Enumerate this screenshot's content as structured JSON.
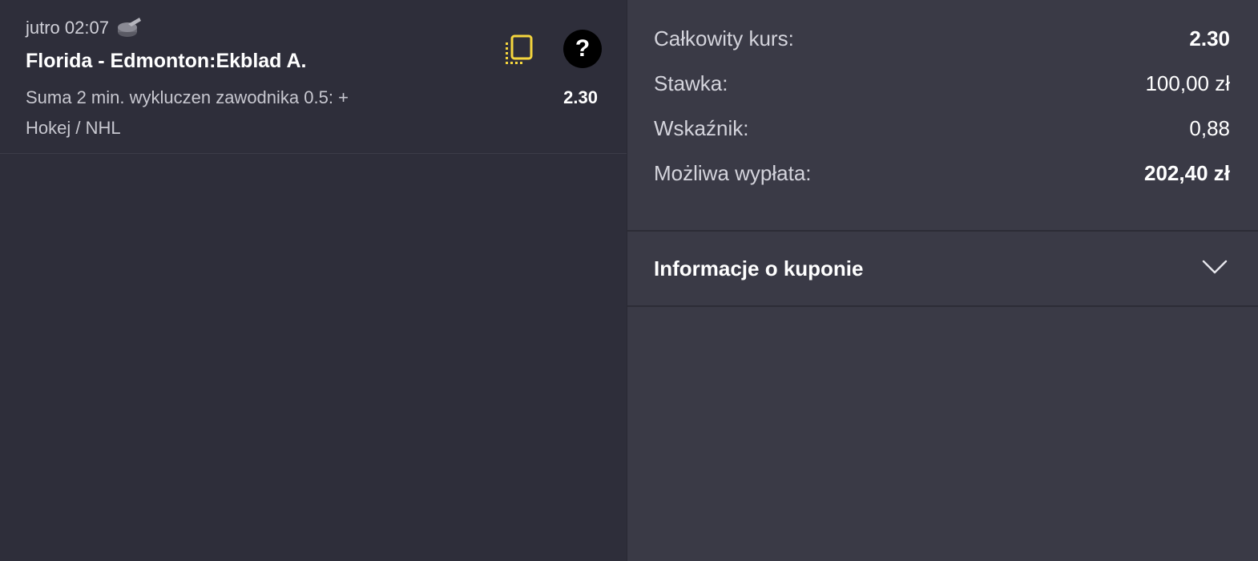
{
  "bet": {
    "time": "jutro 02:07",
    "title": "Florida - Edmonton:Ekblad A.",
    "market": "Suma 2 min. wykluczen zawodnika 0.5: +",
    "odds": "2.30",
    "sport": "Hokej / NHL",
    "icons": {
      "sport": "hockey-puck-icon",
      "copy": "copy-icon",
      "help": "help-icon"
    },
    "help_glyph": "?"
  },
  "summary": {
    "total_odds_label": "Całkowity kurs:",
    "total_odds_value": "2.30",
    "stake_label": "Stawka:",
    "stake_value": "100,00 zł",
    "indicator_label": "Wskaźnik:",
    "indicator_value": "0,88",
    "payout_label": "Możliwa wypłata:",
    "payout_value": "202,40 zł"
  },
  "coupon_info": {
    "label": "Informacje o kuponie",
    "icon": "chevron-down-icon"
  },
  "colors": {
    "left_bg": "#2e2e3a",
    "right_bg": "#3a3a46",
    "accent_yellow": "#f5d63d",
    "help_bg": "#000000"
  }
}
